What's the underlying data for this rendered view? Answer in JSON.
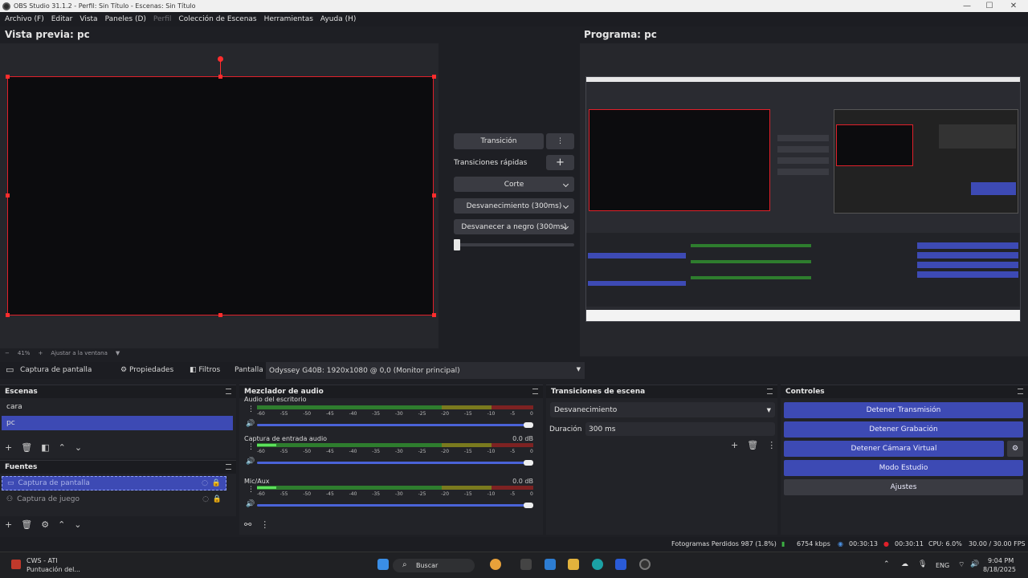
{
  "window": {
    "title": "OBS Studio 31.1.2 - Perfil: Sin Título - Escenas: Sin Título",
    "minimize": "—",
    "maximize": "☐",
    "close": "✕"
  },
  "menu": {
    "items": [
      "Archivo (F)",
      "Editar",
      "Vista",
      "Paneles (D)",
      "Perfil",
      "Colección de Escenas",
      "Herramientas",
      "Ayuda (H)"
    ]
  },
  "preview": {
    "title": "Vista previa: pc",
    "zoom_minus": "−",
    "zoom_level": "41%",
    "zoom_plus": "+",
    "fit_label": "Ajustar a la ventana"
  },
  "program": {
    "title": "Programa: pc"
  },
  "transition_panel": {
    "transition_button": "Transición",
    "quick_label": "Transiciones rápidas",
    "quick": [
      "Corte",
      "Desvanecimiento (300ms)",
      "Desvanecer a negro (300ms)"
    ]
  },
  "sources_toolbar": {
    "source_name": "Captura de pantalla",
    "properties": "Propiedades",
    "filters": "Filtros",
    "display_label": "Pantalla",
    "display_value": "Odyssey G40B: 1920x1080 @ 0,0 (Monitor principal)"
  },
  "scenes": {
    "title": "Escenas",
    "items": [
      "cara",
      "pc"
    ]
  },
  "sources": {
    "title": "Fuentes",
    "items": [
      "Captura de pantalla",
      "Captura de juego"
    ]
  },
  "mixer": {
    "title": "Mezclador de audio",
    "ticks": [
      "-60",
      "-55",
      "-50",
      "-45",
      "-40",
      "-35",
      "-30",
      "-25",
      "-20",
      "-15",
      "-10",
      "-5",
      "0"
    ],
    "channels": [
      {
        "name": "Audio del escritorio",
        "db": "",
        "level": 0.0
      },
      {
        "name": "Captura de entrada audio",
        "db": "0.0 dB",
        "level": 0.07
      },
      {
        "name": "Mic/Aux",
        "db": "0.0 dB",
        "level": 0.07
      }
    ]
  },
  "scene_transitions": {
    "title": "Transiciones de escena",
    "selected": "Desvanecimiento",
    "duration_label": "Duración",
    "duration_value": "300 ms"
  },
  "controls": {
    "title": "Controles",
    "buttons": [
      "Detener Transmisión",
      "Detener Grabación",
      "Detener Cámara Virtual",
      "Modo Estudio",
      "Ajustes"
    ]
  },
  "status": {
    "frames_dropped": "Fotogramas Perdidos 987 (1.8%)",
    "bitrate": "6754 kbps",
    "stream_time": "00:30:13",
    "rec_time": "00:30:11",
    "cpu": "CPU: 6.0%",
    "fps": "30.00 / 30.00 FPS"
  },
  "taskbar": {
    "widget_title": "CWS - ATI",
    "widget_sub": "Puntuación del...",
    "search": "Buscar",
    "lang": "ENG",
    "time": "9:04 PM",
    "date": "8/18/2025"
  },
  "colors": {
    "accent": "#3d4ab4",
    "selection_border": "#e0202a",
    "background": "#1e1f24"
  }
}
